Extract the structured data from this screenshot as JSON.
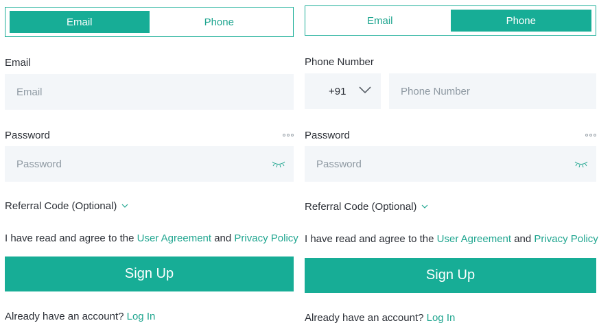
{
  "left": {
    "tabs": [
      {
        "label": "Email",
        "active": true
      },
      {
        "label": "Phone",
        "active": false
      }
    ],
    "email_label": "Email",
    "email_placeholder": "Email",
    "password_label": "Password",
    "password_placeholder": "Password",
    "referral_label": "Referral Code (Optional)",
    "agree": {
      "prefix": "I have read and agree to the ",
      "link1": "User Agreement",
      "middle": " and ",
      "link2": "Privacy Policy"
    },
    "signup_label": "Sign Up",
    "login": {
      "prefix": "Already have an account? ",
      "link": "Log In"
    }
  },
  "right": {
    "tabs": [
      {
        "label": "Email",
        "active": false
      },
      {
        "label": "Phone",
        "active": true
      }
    ],
    "phone_label": "Phone Number",
    "country_code": "+91",
    "phone_placeholder": "Phone Number",
    "password_label": "Password",
    "password_placeholder": "Password",
    "referral_label": "Referral Code (Optional)",
    "agree": {
      "prefix": "I have read and agree to the ",
      "link1": "User Agreement",
      "middle": " and ",
      "link2": "Privacy Policy"
    },
    "signup_label": "Sign Up",
    "login": {
      "prefix": "Already have an account? ",
      "link": "Log In"
    }
  },
  "colors": {
    "accent": "#17ad96",
    "field_bg": "#f3f6f9",
    "link": "#1fa58f"
  },
  "icons": [
    "more-dots-icon",
    "eye-closed-icon",
    "chevron-down-icon"
  ]
}
